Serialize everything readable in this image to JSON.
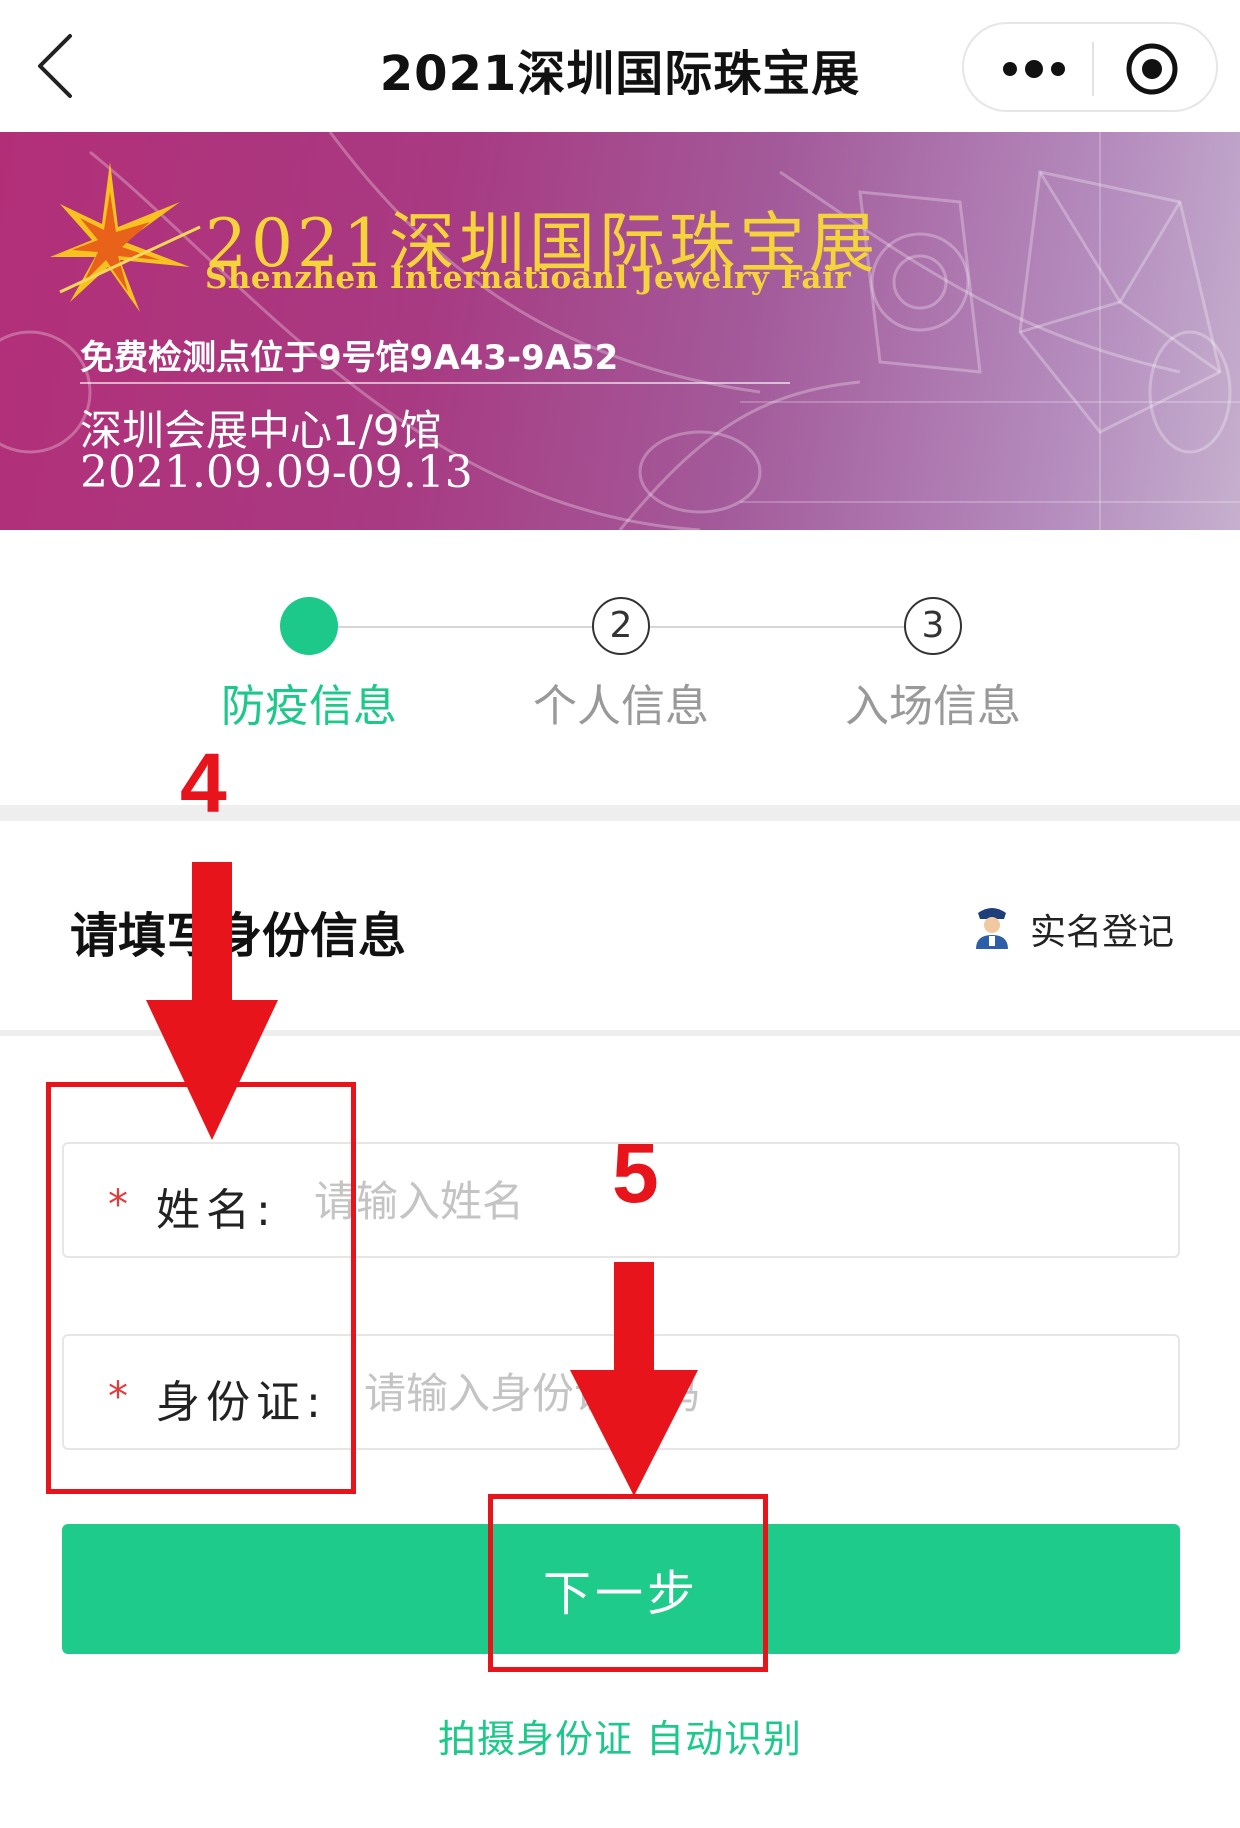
{
  "navbar": {
    "title": "2021深圳国际珠宝展"
  },
  "banner": {
    "title": "2021深圳国际珠宝展",
    "subtitle": "Shenzhen Internatioanl Jewelry Fair",
    "detection_point": "免费检测点位于9号馆9A43-9A52",
    "venue": "深圳会展中心1/9馆",
    "dates": "2021.09.09-09.13"
  },
  "steps": [
    {
      "number": "",
      "label": "防疫信息",
      "state": "active"
    },
    {
      "number": "2",
      "label": "个人信息",
      "state": "pending"
    },
    {
      "number": "3",
      "label": "入场信息",
      "state": "pending"
    }
  ],
  "form": {
    "title": "请填写身份信息",
    "realname_label": "实名登记",
    "required_mark": "*",
    "name_label": "姓名:",
    "name_placeholder": "请输入姓名",
    "name_value": "",
    "id_label": "身份证:",
    "id_placeholder": "请输入身份证号码",
    "id_value": "",
    "next_button": "下一步",
    "scan_link": "拍摄身份证 自动识别"
  },
  "annotations": {
    "step4": "4",
    "step5": "5"
  },
  "colors": {
    "accent_green": "#1dc98a",
    "annotation_red": "#e8141c",
    "banner_gold": "#f5d33a",
    "banner_magenta": "#b22f78"
  },
  "icons": {
    "back": "chevron-left-icon",
    "more": "more-dots-icon",
    "close": "target-circle-icon",
    "realname": "officer-icon",
    "banner": "starburst-icon"
  }
}
